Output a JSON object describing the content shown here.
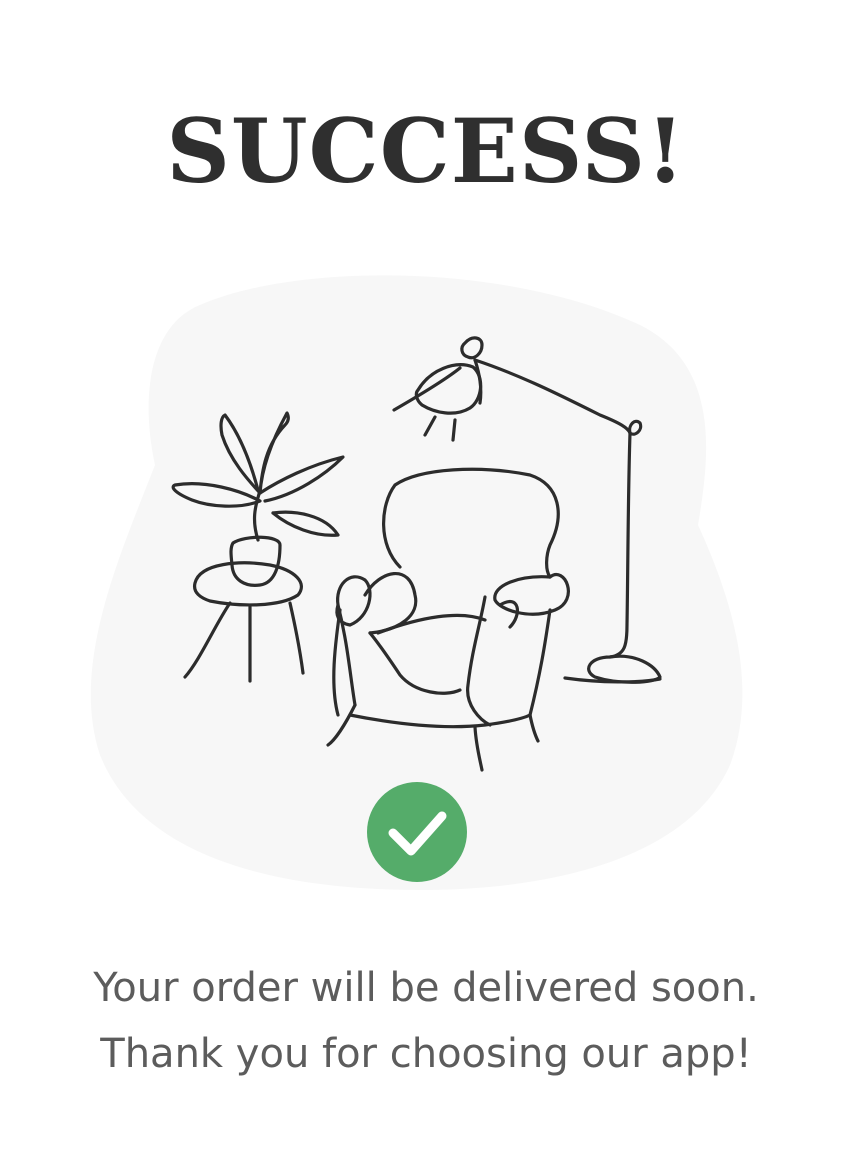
{
  "screen": {
    "title": "SUCCESS!",
    "message_line_1": "Your order will be delivered soon.",
    "message_line_2": "Thank you for choosing our app!"
  },
  "colors": {
    "title": "#2f2f2f",
    "message": "#5c5c5c",
    "blob_background": "#f7f7f7",
    "line_art": "#2c2c2c",
    "success_badge": "#55ac6a",
    "check_mark": "#ffffff"
  },
  "icons": {
    "success": "check-circle-icon",
    "illustration": "armchair-plant-lamp-illustration"
  }
}
